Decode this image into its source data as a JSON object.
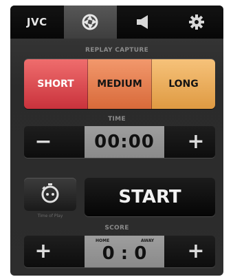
{
  "tabs": [
    {
      "label": "JVC",
      "icon": null
    },
    {
      "label": "",
      "icon": "camera-aperture-icon"
    },
    {
      "label": "",
      "icon": "speaker-icon"
    },
    {
      "label": "",
      "icon": "gear-icon"
    }
  ],
  "replay": {
    "section_label": "REPLAY CAPTURE",
    "short_label": "SHORT",
    "medium_label": "MEDIUM",
    "long_label": "LONG"
  },
  "time": {
    "section_label": "TIME",
    "minus_label": "−",
    "value": "00:00",
    "plus_label": "+"
  },
  "start": {
    "timer_icon": "stopwatch-icon",
    "timer_caption": "Time of Play",
    "label": "START"
  },
  "score": {
    "section_label": "SCORE",
    "home_label": "HOME",
    "away_label": "AWAY",
    "value": "0 : 0",
    "left_plus_label": "+",
    "right_plus_label": "+"
  },
  "colors": {
    "short": "#d9434b",
    "medium": "#e0784a",
    "long": "#e8a855",
    "background": "#2d2d2d"
  }
}
